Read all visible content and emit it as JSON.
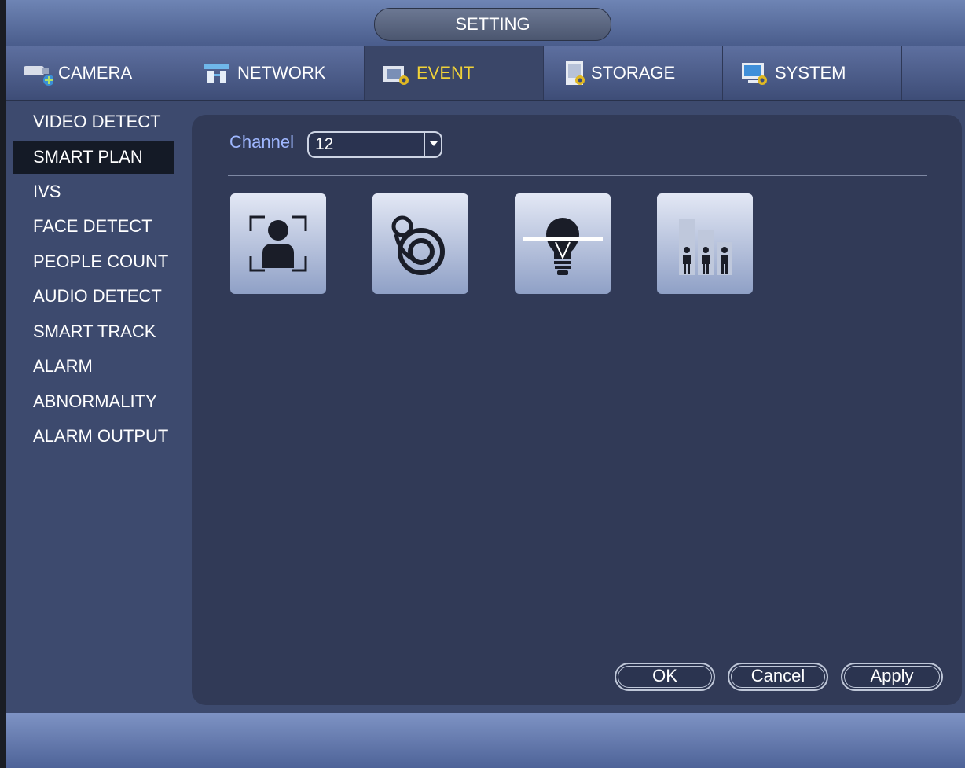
{
  "window": {
    "title": "SETTING"
  },
  "tabs": [
    {
      "label": "CAMERA",
      "icon": "camera-icon",
      "active": false
    },
    {
      "label": "NETWORK",
      "icon": "network-icon",
      "active": false
    },
    {
      "label": "EVENT",
      "icon": "event-icon",
      "active": true
    },
    {
      "label": "STORAGE",
      "icon": "storage-icon",
      "active": false
    },
    {
      "label": "SYSTEM",
      "icon": "system-icon",
      "active": false
    }
  ],
  "sidebar": {
    "items": [
      {
        "label": "VIDEO DETECT"
      },
      {
        "label": "SMART PLAN",
        "active": true
      },
      {
        "label": "IVS"
      },
      {
        "label": "FACE DETECT"
      },
      {
        "label": "PEOPLE COUNT"
      },
      {
        "label": "AUDIO DETECT"
      },
      {
        "label": "SMART TRACK"
      },
      {
        "label": "ALARM"
      },
      {
        "label": "ABNORMALITY"
      },
      {
        "label": "ALARM OUTPUT"
      }
    ]
  },
  "main": {
    "channel_label": "Channel",
    "channel_value": "12",
    "plan_icons": [
      "face-detect-icon",
      "fisheye-icon",
      "ivs-bulb-icon",
      "people-count-icon"
    ]
  },
  "buttons": {
    "ok": "OK",
    "cancel": "Cancel",
    "apply": "Apply"
  },
  "colors": {
    "active_tab_text": "#f0d238",
    "channel_label": "#9fb7ff"
  }
}
